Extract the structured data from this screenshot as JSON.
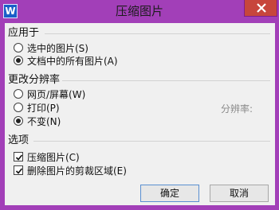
{
  "window": {
    "title": "压缩图片",
    "app_icon_letter": "W",
    "accent_color": "#a23fb8"
  },
  "apply_to": {
    "label": "应用于",
    "options": [
      {
        "label": "选中的图片(S)",
        "selected": false
      },
      {
        "label": "文档中的所有图片(A)",
        "selected": true
      }
    ]
  },
  "resolution": {
    "label": "更改分辨率",
    "options": [
      {
        "label": "网页/屏幕(W)",
        "selected": false
      },
      {
        "label": "打印(P)",
        "selected": false
      },
      {
        "label": "不变(N)",
        "selected": true
      }
    ],
    "resolution_label": "分辨率:"
  },
  "options": {
    "label": "选项",
    "items": [
      {
        "label": "压缩图片(C)",
        "checked": true
      },
      {
        "label": "删除图片的剪裁区域(E)",
        "checked": true
      }
    ]
  },
  "buttons": {
    "ok": "确定",
    "cancel": "取消"
  }
}
